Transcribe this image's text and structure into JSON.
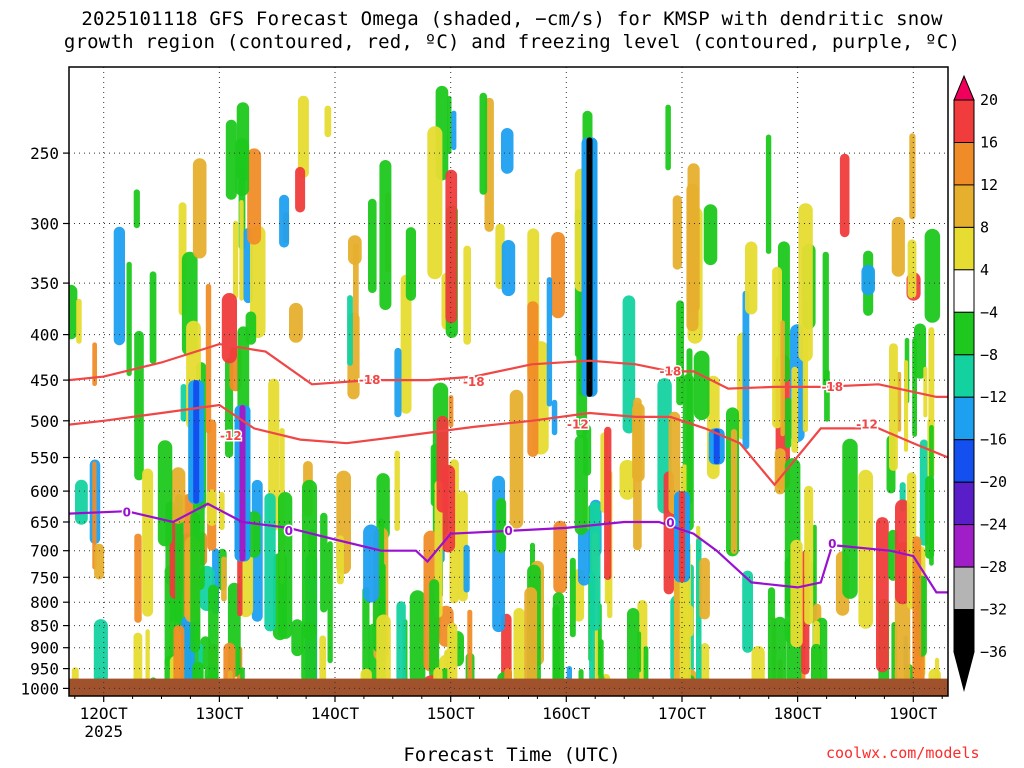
{
  "chart_data": {
    "type": "heatmap",
    "title_line1": "2025101118 GFS Forecast Omega (shaded, −cm/s) for KMSP with dendritic snow",
    "title_line2": "growth region (contoured, red, ºC) and freezing level (contoured, purple, ºC)",
    "xlabel": "Forecast Time (UTC)",
    "credit": "coolwx.com/models",
    "x_ticks": [
      {
        "label": "12OCT",
        "sub": "2025",
        "day": 12
      },
      {
        "label": "13OCT",
        "sub": "",
        "day": 13
      },
      {
        "label": "14OCT",
        "sub": "",
        "day": 14
      },
      {
        "label": "15OCT",
        "sub": "",
        "day": 15
      },
      {
        "label": "16OCT",
        "sub": "",
        "day": 16
      },
      {
        "label": "17OCT",
        "sub": "",
        "day": 17
      },
      {
        "label": "18OCT",
        "sub": "",
        "day": 18
      },
      {
        "label": "19OCT",
        "sub": "",
        "day": 19
      }
    ],
    "xlim": [
      11.7,
      19.3
    ],
    "y_ticks": [
      250,
      300,
      350,
      400,
      450,
      500,
      550,
      600,
      650,
      700,
      750,
      800,
      850,
      900,
      950,
      1000
    ],
    "ylim": [
      1020,
      200
    ],
    "y_scale": "log",
    "grid": true,
    "colorbar": {
      "labels": [
        "20",
        "16",
        "12",
        "8",
        "4",
        "−4",
        "−8",
        "−12",
        "−16",
        "−20",
        "−24",
        "−28",
        "−32",
        "−36"
      ],
      "colors": [
        "#f0005a",
        "#f03c3c",
        "#f08c28",
        "#e6af2d",
        "#e6dc32",
        "#ffffff",
        "#1ec81e",
        "#14d2a0",
        "#1ea0f0",
        "#1450f0",
        "#5a1ec8",
        "#a01ec8",
        "#b4b4b4",
        "#000000"
      ],
      "placement": "right"
    },
    "contours": {
      "red": [
        {
          "label": "-18",
          "points": [
            [
              11.7,
              450
            ],
            [
              12.0,
              446
            ],
            [
              12.5,
              430
            ],
            [
              13.0,
              410
            ],
            [
              13.4,
              418
            ],
            [
              13.8,
              455
            ],
            [
              14.3,
              450
            ],
            [
              14.8,
              450
            ],
            [
              15.2,
              446
            ],
            [
              15.7,
              432
            ],
            [
              16.2,
              428
            ],
            [
              16.6,
              432
            ],
            [
              16.9,
              440
            ],
            [
              17.1,
              440
            ],
            [
              17.4,
              460
            ],
            [
              17.8,
              458
            ],
            [
              18.2,
              458
            ],
            [
              18.7,
              455
            ],
            [
              19.2,
              470
            ],
            [
              19.3,
              470
            ]
          ],
          "label_at": [
            14.3,
            450
          ]
        },
        {
          "label": "-12",
          "points": [
            [
              11.7,
              505
            ],
            [
              12.0,
              500
            ],
            [
              12.5,
              490
            ],
            [
              13.0,
              480
            ],
            [
              13.3,
              510
            ],
            [
              13.7,
              525
            ],
            [
              14.1,
              530
            ],
            [
              14.6,
              520
            ],
            [
              15.2,
              508
            ],
            [
              15.7,
              500
            ],
            [
              16.2,
              490
            ],
            [
              16.6,
              495
            ],
            [
              16.9,
              495
            ],
            [
              17.2,
              510
            ],
            [
              17.5,
              530
            ],
            [
              17.8,
              590
            ],
            [
              18.2,
              510
            ],
            [
              18.7,
              510
            ],
            [
              19.0,
              530
            ],
            [
              19.3,
              550
            ]
          ],
          "label_at": [
            16.1,
            505
          ]
        },
        {
          "label": "-12",
          "points": [],
          "label_at": [
            13.1,
            520
          ]
        },
        {
          "label": "-18",
          "points": [],
          "label_at": [
            16.9,
            440
          ]
        },
        {
          "label": "-18",
          "points": [],
          "label_at": [
            18.3,
            458
          ]
        },
        {
          "label": "-12",
          "points": [],
          "label_at": [
            18.6,
            505
          ]
        },
        {
          "label": "-18",
          "points": [],
          "label_at": [
            15.2,
            452
          ]
        }
      ],
      "purple": [
        {
          "label": "0",
          "points": [
            [
              11.7,
              636
            ],
            [
              12.2,
              632
            ],
            [
              12.6,
              650
            ],
            [
              12.9,
              620
            ],
            [
              13.2,
              650
            ],
            [
              13.6,
              660
            ],
            [
              14.0,
              680
            ],
            [
              14.4,
              700
            ],
            [
              14.7,
              700
            ],
            [
              14.8,
              720
            ],
            [
              15.0,
              670
            ],
            [
              15.5,
              665
            ],
            [
              16.0,
              660
            ],
            [
              16.5,
              650
            ],
            [
              16.8,
              650
            ],
            [
              17.1,
              670
            ],
            [
              17.3,
              700
            ],
            [
              17.6,
              760
            ],
            [
              18.0,
              770
            ],
            [
              18.2,
              760
            ],
            [
              18.3,
              690
            ],
            [
              18.8,
              700
            ],
            [
              19.0,
              710
            ],
            [
              19.2,
              780
            ],
            [
              19.3,
              780
            ]
          ],
          "label_at": [
            12.2,
            634
          ]
        },
        {
          "label": "0",
          "points": [],
          "label_at": [
            13.6,
            665
          ]
        },
        {
          "label": "0",
          "points": [],
          "label_at": [
            15.5,
            665
          ]
        },
        {
          "label": "0",
          "points": [],
          "label_at": [
            16.9,
            652
          ]
        },
        {
          "label": "0",
          "points": [],
          "label_at": [
            18.3,
            688
          ]
        }
      ]
    },
    "shaded_features": [
      {
        "x": 13.2,
        "p_top": 480,
        "p_bot": 720,
        "value": -28
      },
      {
        "x": 16.2,
        "p_top": 240,
        "p_bot": 470,
        "value": -36
      },
      {
        "x": 12.8,
        "p_top": 450,
        "p_bot": 620,
        "value": -20
      },
      {
        "x": 17.0,
        "p_top": 600,
        "p_bot": 760,
        "value": 16
      },
      {
        "x": 17.3,
        "p_top": 510,
        "p_bot": 560,
        "value": -20
      }
    ],
    "ground_band": {
      "p_top": 975,
      "color": "#a0522d"
    }
  }
}
